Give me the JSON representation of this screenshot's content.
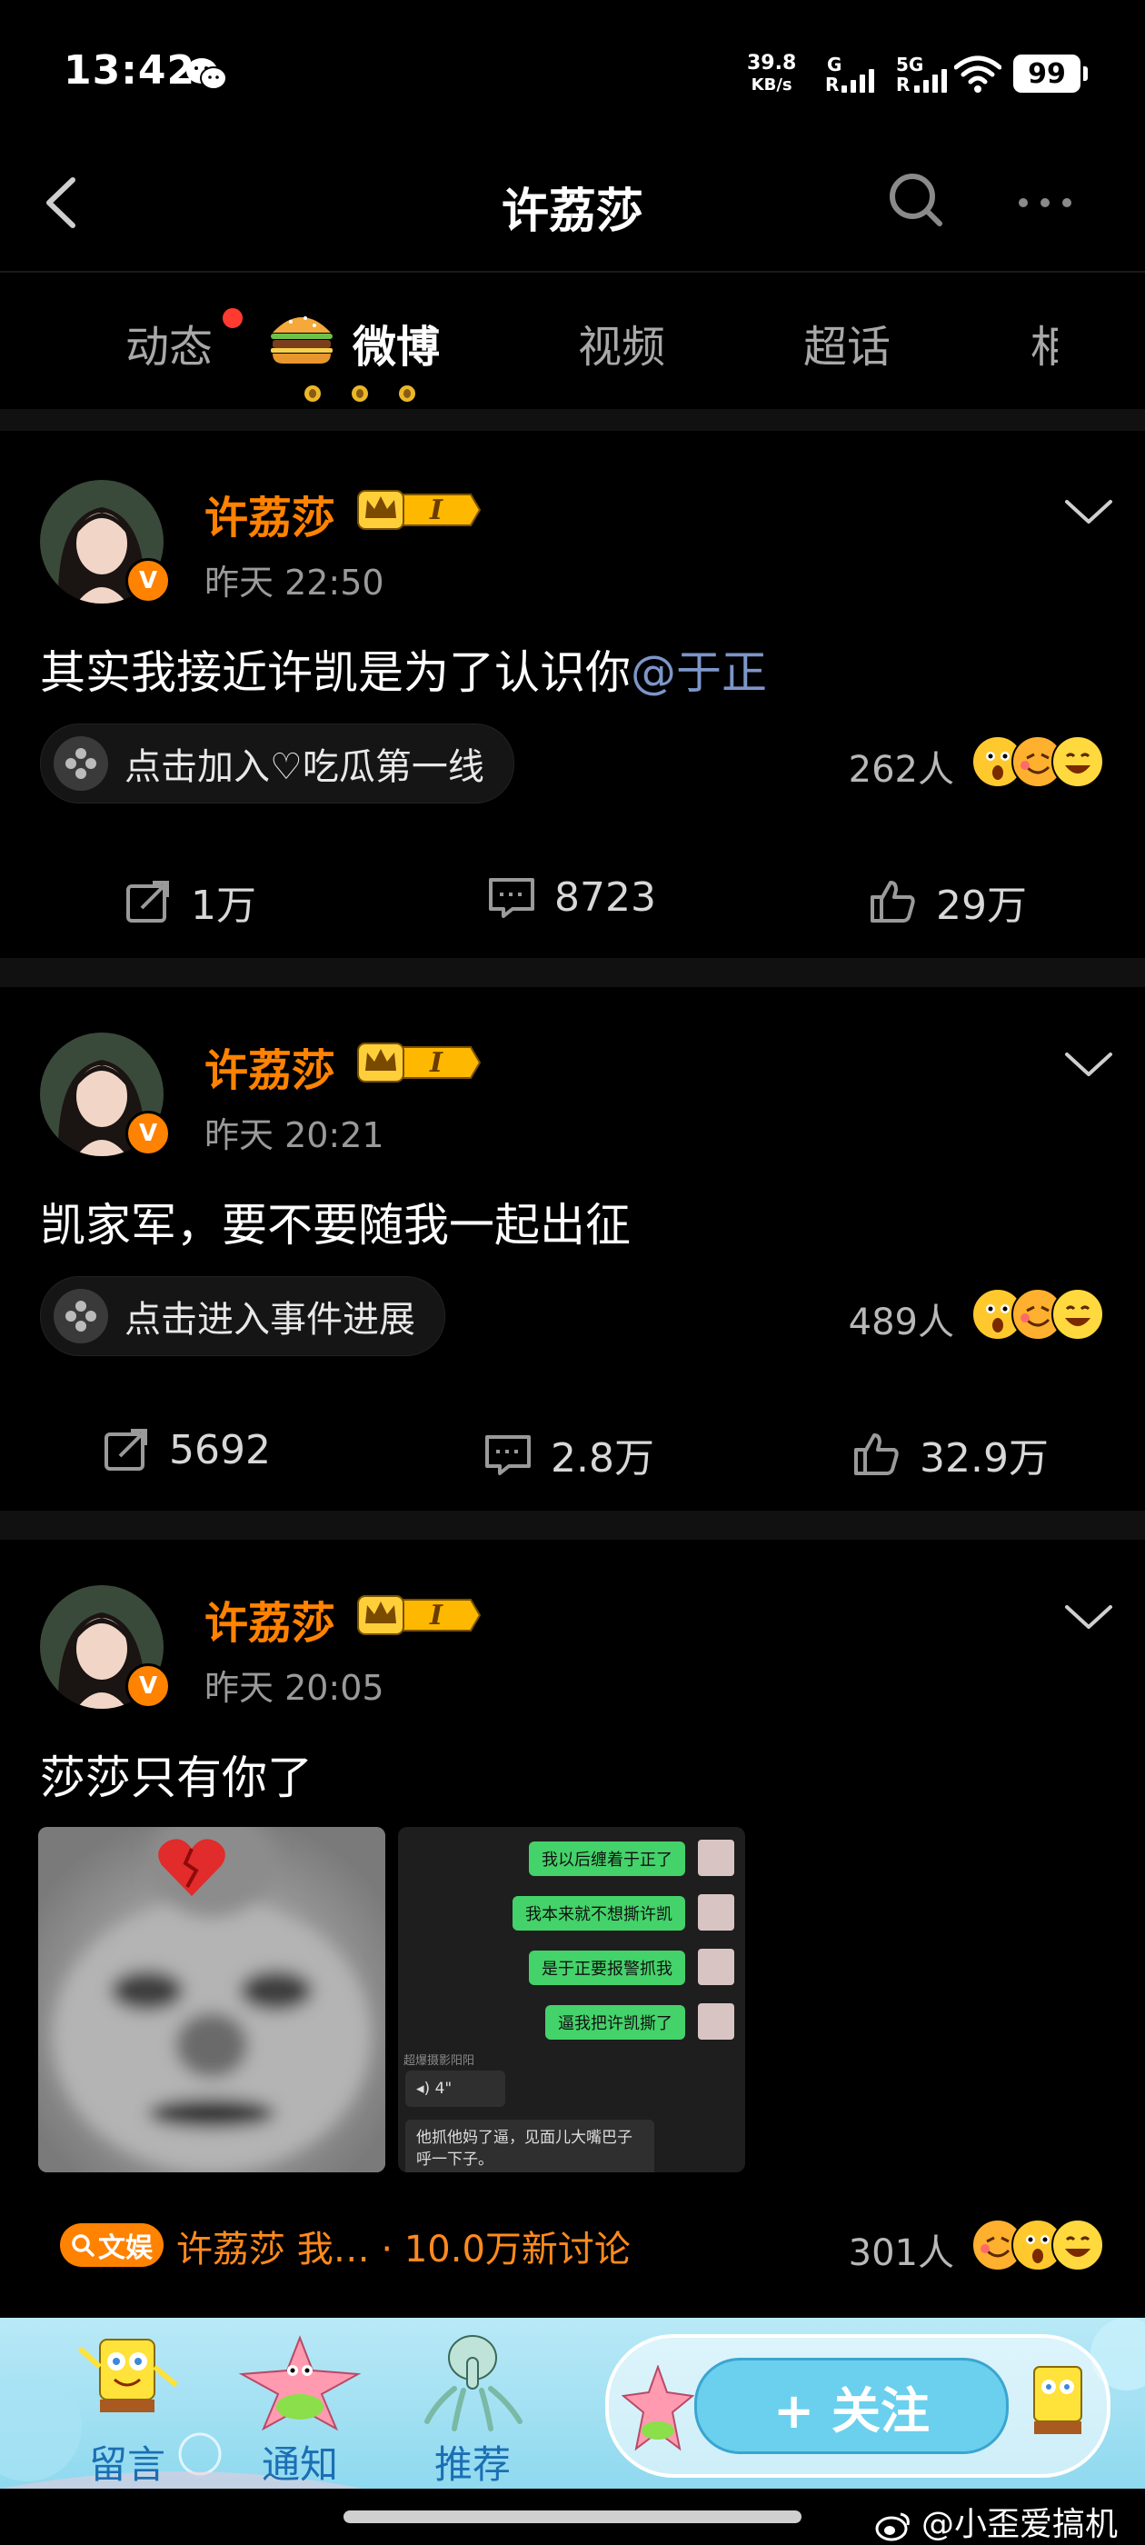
{
  "status_bar": {
    "time": "13:42",
    "net_speed_value": "39.8",
    "net_speed_unit": "KB/s",
    "sim1_label_top": "G",
    "sim1_label_bottom": "R",
    "sim2_label_top": "5G",
    "sim2_label_bottom": "R",
    "battery": "99"
  },
  "nav": {
    "title": "许荔莎"
  },
  "tabs": [
    {
      "label": "动态",
      "has_dot": true
    },
    {
      "label": "微博",
      "active": true
    },
    {
      "label": "视频"
    },
    {
      "label": "超话"
    },
    {
      "label": "相"
    }
  ],
  "posts": [
    {
      "author": "许荔莎",
      "badge_level": "I",
      "time": "昨天 22:50",
      "text": "其实我接近许凯是为了认识你",
      "mention": "@于正",
      "topic_label": "点击加入♡吃瓜第一线",
      "people_count": "262人",
      "reposts": "1万",
      "comments": "8723",
      "likes": "29万"
    },
    {
      "author": "许荔莎",
      "badge_level": "I",
      "time": "昨天 20:21",
      "text": "凯家军，要不要随我一起出征",
      "topic_label": "点击进入事件进展",
      "people_count": "489人",
      "reposts": "5692",
      "comments": "2.8万",
      "likes": "32.9万"
    },
    {
      "author": "许荔莎",
      "badge_level": "I",
      "time": "昨天 20:05",
      "text": "莎莎只有你了",
      "chat_lines": [
        "我以后缠着于正了",
        "我本来就不想撕许凯",
        "是于正要报警抓我",
        "逼我把许凯撕了"
      ],
      "chat_name": "超爆摄影阳阳",
      "chat_voice": "4\"",
      "chat_reply": "他抓他妈了逼，见面儿大嘴巴子呼一下子。",
      "topic_tag": "文娱",
      "topic_line": "许荔莎 我… · 10.0万新讨论",
      "people_count": "301人"
    }
  ],
  "bottom_bar": {
    "comment_label": "留言",
    "notify_label": "通知",
    "recommend_label": "推荐",
    "follow_label": "+ 关注"
  },
  "watermark": "@小歪爱搞机",
  "colors": {
    "accent_orange": "#ff8200",
    "mention_blue": "#7d96c9",
    "background": "#000000",
    "bottom_bar_blue": "#8fd9ef"
  }
}
